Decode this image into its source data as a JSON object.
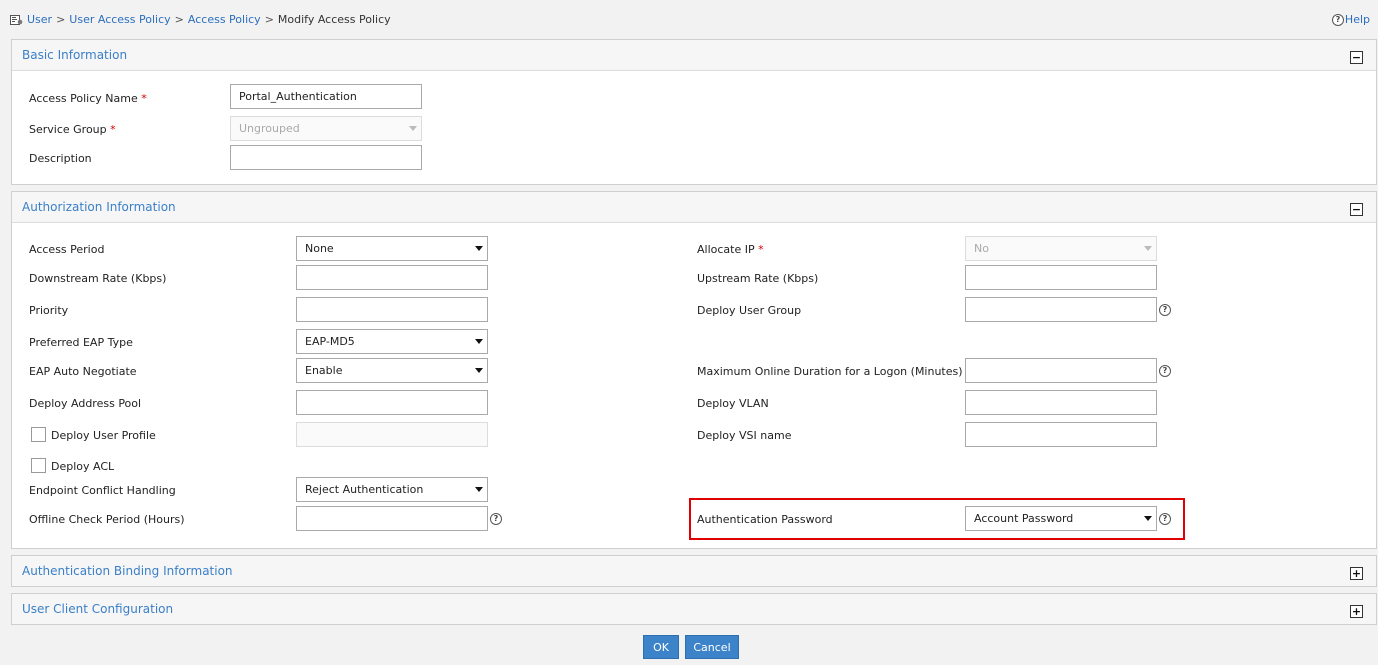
{
  "breadcrumb": {
    "items": [
      "User",
      "User Access Policy",
      "Access Policy"
    ],
    "separator": ">",
    "current": "Modify Access Policy"
  },
  "help": {
    "label": "Help"
  },
  "basic": {
    "title": "Basic Information",
    "toggle": "−",
    "policy_name_label": "Access Policy Name",
    "policy_name_value": "Portal_Authentication",
    "service_group_label": "Service Group",
    "service_group_value": "Ungrouped",
    "description_label": "Description",
    "description_value": "",
    "required_mark": "*"
  },
  "auth": {
    "title": "Authorization Information",
    "toggle": "−",
    "access_period_label": "Access Period",
    "access_period_value": "None",
    "downstream_label": "Downstream Rate (Kbps)",
    "priority_label": "Priority",
    "eap_type_label": "Preferred EAP Type",
    "eap_type_value": "EAP-MD5",
    "eap_negotiate_label": "EAP Auto Negotiate",
    "eap_negotiate_value": "Enable",
    "address_pool_label": "Deploy Address Pool",
    "user_profile_label": "Deploy User Profile",
    "acl_label": "Deploy ACL",
    "conflict_label": "Endpoint Conflict Handling",
    "conflict_value": "Reject Authentication",
    "offline_label": "Offline Check Period (Hours)",
    "allocate_ip_label": "Allocate IP",
    "allocate_ip_value": "No",
    "upstream_label": "Upstream Rate (Kbps)",
    "user_group_label": "Deploy User Group",
    "max_online_label": "Maximum Online Duration for a Logon (Minutes)",
    "vlan_label": "Deploy VLAN",
    "vsi_label": "Deploy VSI name",
    "auth_password_label": "Authentication Password",
    "auth_password_value": "Account Password",
    "help_mark": "?"
  },
  "binding": {
    "title": "Authentication Binding Information",
    "toggle": "+"
  },
  "client": {
    "title": "User Client Configuration",
    "toggle": "+"
  },
  "buttons": {
    "ok": "OK",
    "cancel": "Cancel"
  },
  "colors": {
    "link": "#2a6ebd",
    "panel_title": "#3a7fc8",
    "button": "#3d83c9",
    "highlight": "#e00000",
    "required": "#d40000"
  }
}
